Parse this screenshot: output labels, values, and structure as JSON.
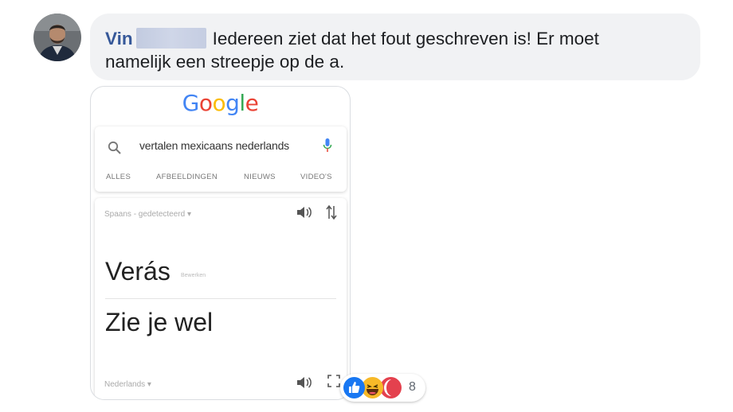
{
  "comment": {
    "author": "Vin",
    "text_line1": "Iedereen ziet dat het fout geschreven is! Er moet",
    "text_line2": "namelijk een streepje op de a."
  },
  "screenshot": {
    "logo": [
      "G",
      "o",
      "o",
      "g",
      "l",
      "e"
    ],
    "logo_colors": [
      "#4285F4",
      "#EA4335",
      "#FBBC05",
      "#4285F4",
      "#34A853",
      "#EA4335"
    ],
    "search_query": "vertalen mexicaans nederlands",
    "tabs": [
      "ALLES",
      "AFBEELDINGEN",
      "NIEUWS",
      "VIDEO'S"
    ],
    "source_language": "Spaans - gedetecteerd ▾",
    "source_word": "Verás",
    "romanization": "Bewerken",
    "translated_word": "Zie je wel",
    "target_language": "Nederlands ▾"
  },
  "reactions": {
    "icons": [
      "like-icon",
      "haha-icon",
      "angry-icon"
    ],
    "colors": {
      "like": "#1877F2",
      "haha": "#F7B928",
      "angry": "#E4414E"
    },
    "count": "8"
  },
  "colors": {
    "author_link": "#365899",
    "bubble_bg": "#f1f2f4"
  }
}
